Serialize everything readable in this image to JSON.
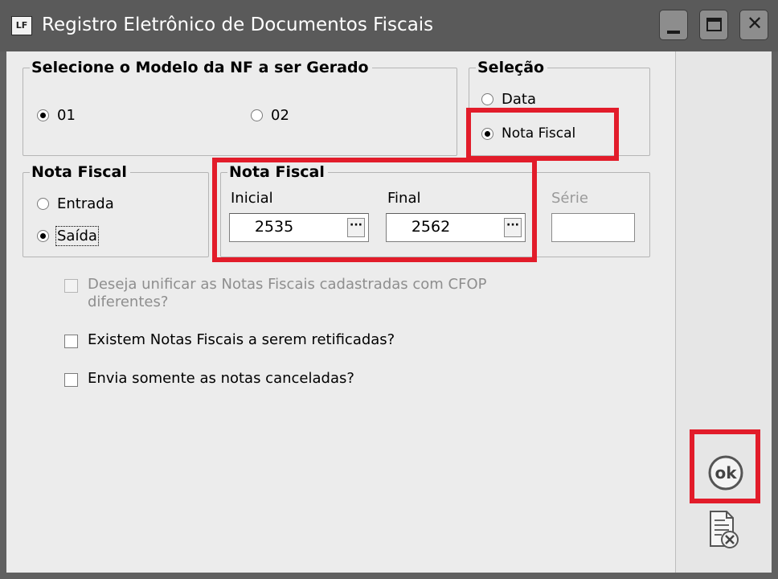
{
  "window": {
    "app_icon_text": "LF",
    "title": "Registro Eletrônico de Documentos Fiscais"
  },
  "modelo_group": {
    "legend": "Selecione o Modelo da NF a ser Gerado",
    "options": [
      "01",
      "02"
    ],
    "selected": "01"
  },
  "selecao_group": {
    "legend": "Seleção",
    "options": [
      "Data",
      "Nota Fiscal"
    ],
    "selected": "Nota Fiscal"
  },
  "tipo_group": {
    "legend": "Nota Fiscal",
    "options": [
      "Entrada",
      "Saída"
    ],
    "selected": "Saída"
  },
  "range_group": {
    "legend": "Nota Fiscal",
    "inicial_label": "Inicial",
    "inicial_value": "2535",
    "final_label": "Final",
    "final_value": "2562",
    "ellipsis": "···",
    "serie_label": "Série",
    "serie_value": ""
  },
  "checkboxes": {
    "unificar": "Deseja unificar as Notas Fiscais cadastradas com CFOP diferentes?",
    "retificadas": "Existem Notas Fiscais a serem retificadas?",
    "canceladas": "Envia somente as notas canceladas?"
  },
  "actions": {
    "ok_label": "ok"
  },
  "colors": {
    "highlight": "#e21c2a",
    "titlebar": "#5a5a5a",
    "panel": "#ececec"
  }
}
